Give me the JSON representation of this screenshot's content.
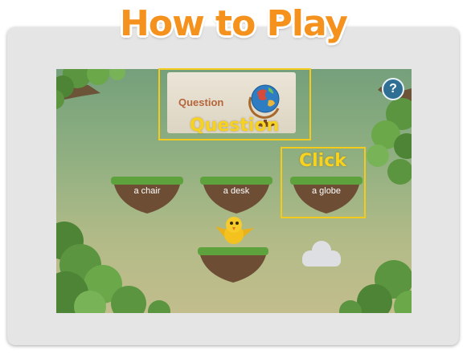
{
  "title": "How to Play",
  "question_card": {
    "label": "Question",
    "image": "globe-image"
  },
  "help_button": {
    "label": "?"
  },
  "answers": [
    {
      "label": "a chair"
    },
    {
      "label": "a desk"
    },
    {
      "label": "a globe"
    }
  ],
  "annotations": {
    "question": "Question",
    "click": "Click"
  },
  "colors": {
    "title": "#f5921e",
    "highlight": "#f5cb1b",
    "card_label": "#b5653a",
    "help": "#2f6f94"
  }
}
